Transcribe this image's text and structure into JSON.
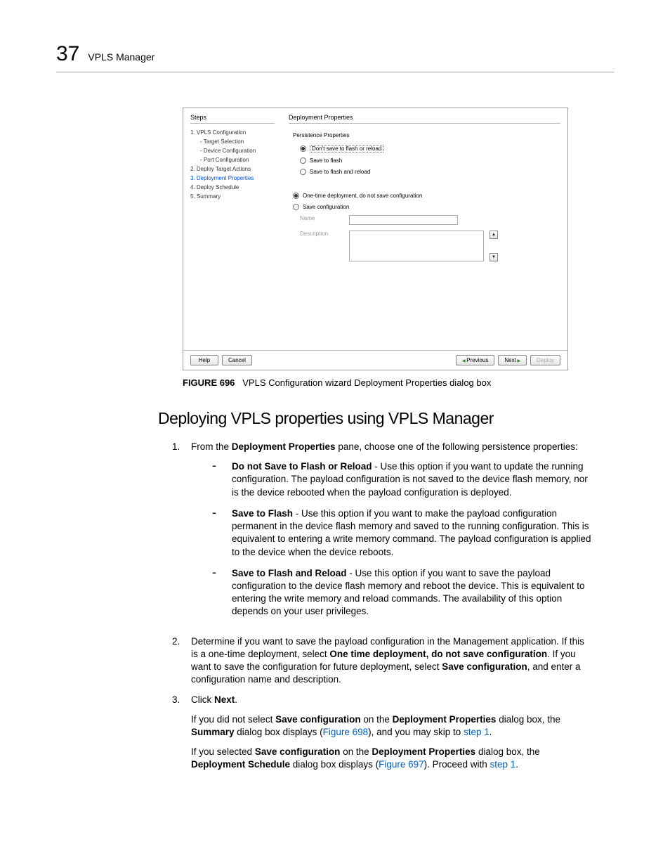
{
  "header": {
    "chapter": "37",
    "title": "VPLS Manager"
  },
  "dialog": {
    "steps_header": "Steps",
    "steps": {
      "s1": "1. VPLS Configuration",
      "s1a": "- Target Selection",
      "s1b": "- Device Configuration",
      "s1c": "- Port Configuration",
      "s2": "2. Deploy Target Actions",
      "s3": "3. Deployment Properties",
      "s4": "4. Deploy Schedule",
      "s5": "5. Summary"
    },
    "props_header": "Deployment Properties",
    "persistence_header": "Persistence Properties",
    "radio1": "Don't save to flash or reload",
    "radio2": "Save to flash",
    "radio3": "Save to flash and reload",
    "radio4": "One-time deployment, do not save configuration",
    "radio5": "Save configuration",
    "name_label": "Name",
    "desc_label": "Description",
    "btn_help": "Help",
    "btn_cancel": "Cancel",
    "btn_prev": "Previous",
    "btn_next": "Next",
    "btn_deploy": "Deploy"
  },
  "figure": {
    "label": "FIGURE 696",
    "caption": "VPLS Configuration wizard Deployment Properties dialog box"
  },
  "section": {
    "heading": "Deploying VPLS properties using VPLS Manager"
  },
  "body": {
    "p1_a": "From the ",
    "p1_b": "Deployment Properties",
    "p1_c": " pane, choose one of the following persistence properties:",
    "b1_a": "Do not Save to Flash or Reload",
    "b1_b": " - Use this option if you want to update the running configuration. The payload configuration is not saved to the device flash memory, nor is the device rebooted when the payload configuration is deployed.",
    "b2_a": "Save to Flash",
    "b2_b": " - Use this option if you want to make the payload configuration permanent in the device flash memory and saved to the running configuration. This is equivalent to entering a write memory command. The payload configuration is applied to the device when the device reboots.",
    "b3_a": "Save to Flash and Reload",
    "b3_b": " - Use this option if you want to save the payload configuration to the device flash memory and reboot the device. This is equivalent to entering the write memory and reload commands. The availability of this option depends on your user privileges.",
    "p2_a": "Determine if you want to save the payload configuration in the Management application. If this is a one-time deployment, select ",
    "p2_b": "One time deployment, do not save configuration",
    "p2_c": ". If you want to save the configuration for future deployment, select ",
    "p2_d": "Save configuration",
    "p2_e": ", and enter a configuration name and description.",
    "p3_a": "Click ",
    "p3_b": "Next",
    "p3_c": ".",
    "p4_a": "If you did not select ",
    "p4_b": "Save configuration",
    "p4_c": " on the ",
    "p4_d": "Deployment Properties",
    "p4_e": " dialog box, the ",
    "p4_f": "Summary",
    "p4_g": " dialog box displays (",
    "p4_link1": "Figure 698",
    "p4_h": "), and you may skip to ",
    "p4_link2": "step 1",
    "p4_i": ".",
    "p5_a": "If you selected ",
    "p5_b": "Save configuration",
    "p5_c": " on the ",
    "p5_d": "Deployment Properties",
    "p5_e": " dialog box, the ",
    "p5_f": "Deployment Schedule",
    "p5_g": " dialog box displays (",
    "p5_link1": "Figure 697",
    "p5_h": "). Proceed with ",
    "p5_link2": "step 1",
    "p5_i": "."
  }
}
